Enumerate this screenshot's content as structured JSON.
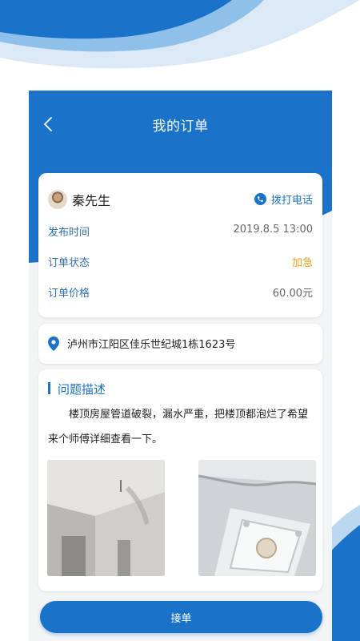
{
  "nav": {
    "title": "我的订单",
    "back_icon": "chevron-left-icon"
  },
  "customer": {
    "name": "秦先生",
    "call_label": "拨打电话",
    "call_icon": "phone-icon"
  },
  "order": {
    "rows": [
      {
        "label": "发布时间",
        "value": "2019.8.5 13:00"
      },
      {
        "label": "订单状态",
        "value": "加急"
      },
      {
        "label": "订单价格",
        "value": "60.00元"
      }
    ]
  },
  "address": {
    "text": "泸州市江阳区佳乐世纪城1栋1623号",
    "icon": "location-pin-icon"
  },
  "problem": {
    "title": "问题描述",
    "description": "楼顶房屋管道破裂，漏水严重，把楼顶都泡烂了希望来个师傅详细查看一下。"
  },
  "actions": {
    "accept_label": "接单"
  },
  "colors": {
    "primary": "#1a73c9",
    "urgent": "#f0a21c",
    "label": "#2d6fb3",
    "background": "#f3f4f6"
  }
}
